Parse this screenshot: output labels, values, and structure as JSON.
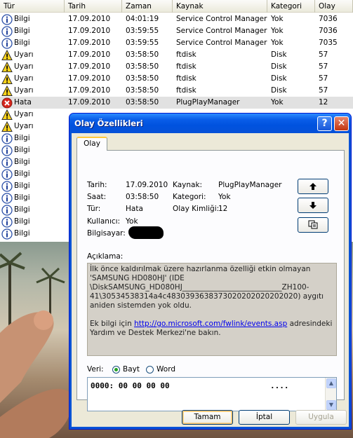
{
  "event_list": {
    "columns": [
      "Tür",
      "Tarih",
      "Zaman",
      "Kaynak",
      "Kategori",
      "Olay"
    ],
    "rows": [
      {
        "icon": "info-icon",
        "type": "Bilgi",
        "date": "17.09.2010",
        "time": "04:01:19",
        "source": "Service Control Manager",
        "category": "Yok",
        "event": "7036"
      },
      {
        "icon": "info-icon",
        "type": "Bilgi",
        "date": "17.09.2010",
        "time": "03:59:55",
        "source": "Service Control Manager",
        "category": "Yok",
        "event": "7036"
      },
      {
        "icon": "info-icon",
        "type": "Bilgi",
        "date": "17.09.2010",
        "time": "03:59:55",
        "source": "Service Control Manager",
        "category": "Yok",
        "event": "7035"
      },
      {
        "icon": "warning-icon",
        "type": "Uyarı",
        "date": "17.09.2010",
        "time": "03:58:50",
        "source": "ftdisk",
        "category": "Disk",
        "event": "57"
      },
      {
        "icon": "warning-icon",
        "type": "Uyarı",
        "date": "17.09.2010",
        "time": "03:58:50",
        "source": "ftdisk",
        "category": "Disk",
        "event": "57"
      },
      {
        "icon": "warning-icon",
        "type": "Uyarı",
        "date": "17.09.2010",
        "time": "03:58:50",
        "source": "ftdisk",
        "category": "Disk",
        "event": "57"
      },
      {
        "icon": "warning-icon",
        "type": "Uyarı",
        "date": "17.09.2010",
        "time": "03:58:50",
        "source": "ftdisk",
        "category": "Disk",
        "event": "57"
      },
      {
        "icon": "error-icon",
        "type": "Hata",
        "date": "17.09.2010",
        "time": "03:58:50",
        "source": "PlugPlayManager",
        "category": "Yok",
        "event": "12",
        "selected": true
      },
      {
        "icon": "warning-icon",
        "type": "Uyarı"
      },
      {
        "icon": "warning-icon",
        "type": "Uyarı"
      },
      {
        "icon": "info-icon",
        "type": "Bilgi"
      },
      {
        "icon": "info-icon",
        "type": "Bilgi"
      },
      {
        "icon": "info-icon",
        "type": "Bilgi"
      },
      {
        "icon": "info-icon",
        "type": "Bilgi"
      },
      {
        "icon": "info-icon",
        "type": "Bilgi"
      },
      {
        "icon": "info-icon",
        "type": "Bilgi"
      },
      {
        "icon": "info-icon",
        "type": "Bilgi"
      },
      {
        "icon": "info-icon",
        "type": "Bilgi"
      },
      {
        "icon": "info-icon",
        "type": "Bilgi"
      }
    ]
  },
  "dialog": {
    "title": "Olay Özellikleri",
    "help_label": "?",
    "close_label": "✕",
    "tab_label": "Olay",
    "fields": {
      "date_label": "Tarih:",
      "date_value": "17.09.2010",
      "time_label": "Saat:",
      "time_value": "03:58:50",
      "type_label": "Tür:",
      "type_value": "Hata",
      "user_label": "Kullanıcı:",
      "user_value": "Yok",
      "computer_label": "Bilgisayar:",
      "source_label": "Kaynak:",
      "source_value": "PlugPlayManager",
      "category_label": "Kategori:",
      "category_value": "Yok",
      "event_id_label": "Olay Kimliği:",
      "event_id_value": "12"
    },
    "nav": {
      "up_icon": "arrow-up-icon",
      "down_icon": "arrow-down-icon",
      "copy_icon": "copy-icon"
    },
    "description_label": "Açıklama:",
    "description_text": "İlk önce kaldırılmak üzere hazırlanma özelliği etkin olmayan 'SAMSUNG HD080HJ' (IDE \\DiskSAMSUNG_HD080HJ___________________________ZH100-41\\30534538314a4c4830393638373020202020202020) aygıtı aniden sistemden yok oldu.",
    "description_more_prefix": "Ek bilgi için ",
    "description_link": "http://go.microsoft.com/fwlink/events.asp",
    "description_more_suffix": " adresindeki Yardım ve Destek Merkezi'ne bakın.",
    "data_label": "Veri:",
    "radio_bytes": "Bayt",
    "radio_word": "Word",
    "data_hex": "0000: 00 00 00 00",
    "data_ascii": "....",
    "buttons": {
      "ok": "Tamam",
      "cancel": "İptal",
      "apply": "Uygula"
    }
  }
}
